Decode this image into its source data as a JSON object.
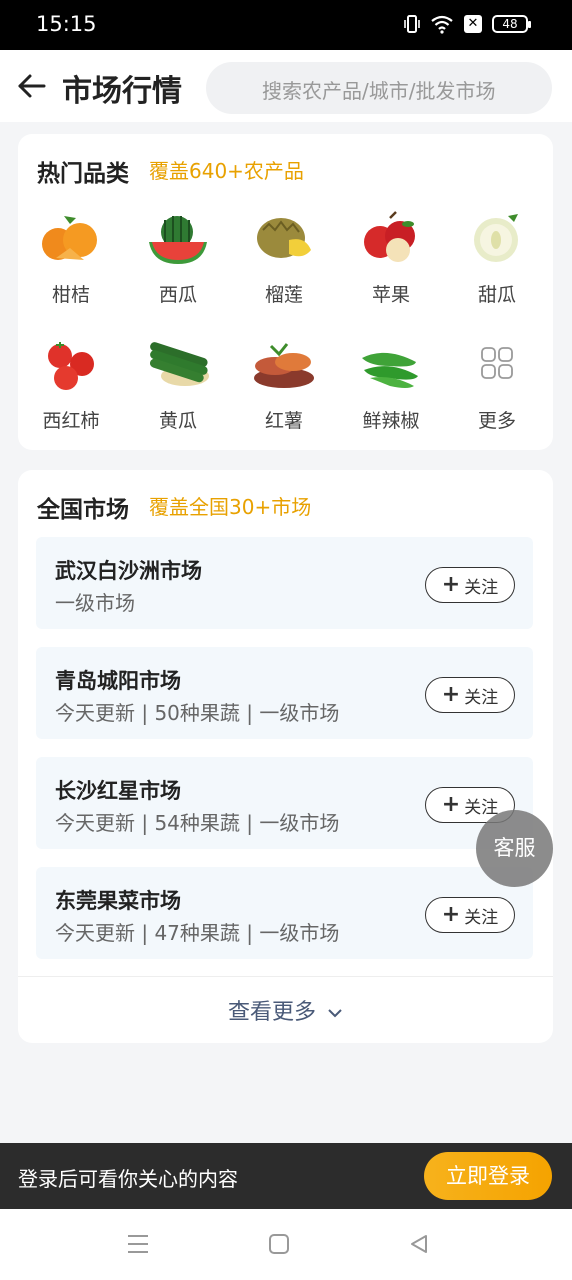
{
  "status_bar": {
    "time": "15:15",
    "battery": "48"
  },
  "header": {
    "title": "市场行情",
    "search_placeholder": "搜索农产品/城市/批发市场"
  },
  "hot_categories": {
    "title": "热门品类",
    "subtitle": "覆盖640+农产品",
    "items": [
      {
        "label": "柑桔",
        "icon": "orange-icon"
      },
      {
        "label": "西瓜",
        "icon": "watermelon-icon"
      },
      {
        "label": "榴莲",
        "icon": "durian-icon"
      },
      {
        "label": "苹果",
        "icon": "apple-icon"
      },
      {
        "label": "甜瓜",
        "icon": "melon-icon"
      },
      {
        "label": "西红柿",
        "icon": "tomato-icon"
      },
      {
        "label": "黄瓜",
        "icon": "cucumber-icon"
      },
      {
        "label": "红薯",
        "icon": "sweet-potato-icon"
      },
      {
        "label": "鲜辣椒",
        "icon": "pepper-icon"
      },
      {
        "label": "更多",
        "icon": "more-grid-icon"
      }
    ]
  },
  "markets": {
    "title": "全国市场",
    "subtitle": "覆盖全国30+市场",
    "follow_label": "关注",
    "items": [
      {
        "name": "武汉白沙洲市场",
        "meta": "一级市场"
      },
      {
        "name": "青岛城阳市场",
        "meta": "今天更新 | 50种果蔬 | 一级市场"
      },
      {
        "name": "长沙红星市场",
        "meta": "今天更新 | 54种果蔬 | 一级市场"
      },
      {
        "name": "东莞果菜市场",
        "meta": "今天更新 | 47种果蔬 | 一级市场"
      }
    ],
    "more_label": "查看更多"
  },
  "customer_service": "客服",
  "login_bar": {
    "tip": "登录后可看你关心的内容",
    "button": "立即登录"
  }
}
